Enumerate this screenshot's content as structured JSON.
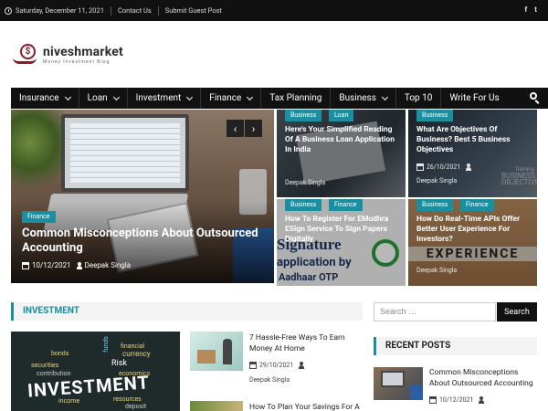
{
  "topbar": {
    "date": "Saturday, December 11, 2021",
    "links": [
      "Contact Us",
      "Submit Guest Post"
    ],
    "social": [
      "f",
      "t"
    ]
  },
  "logo": {
    "mark": "$",
    "title": "niveshmarket",
    "tagline": "Money Investment Blog"
  },
  "nav": {
    "items": [
      {
        "label": "Insurance",
        "dropdown": true
      },
      {
        "label": "Loan",
        "dropdown": true
      },
      {
        "label": "Investment",
        "dropdown": true
      },
      {
        "label": "Finance",
        "dropdown": true
      },
      {
        "label": "Tax Planning",
        "dropdown": false
      },
      {
        "label": "Business",
        "dropdown": true
      },
      {
        "label": "Top 10",
        "dropdown": false
      },
      {
        "label": "Write For Us",
        "dropdown": false
      }
    ]
  },
  "hero": {
    "category": "Finance",
    "title": "Common Misconceptions About Outsourced Accounting",
    "date": "10/12/2021",
    "author": "Deepak Singla",
    "prev": "‹",
    "next": "›"
  },
  "tiles": [
    {
      "cats": [
        "Business",
        "Loan"
      ],
      "title": "Here's Your Simplified Reading Of A Business Loan Application In India",
      "date": "",
      "author": "Deepak Singla"
    },
    {
      "cats": [
        "Business"
      ],
      "title": "What Are Objectives Of Business? Best 5 Business Objectives",
      "date": "26/10/2021",
      "author": "Deepak Singla"
    },
    {
      "cats": [
        "Business",
        "Finance"
      ],
      "title": "How To Register For EMudhra ESign Service To Sign Papers Digitally",
      "date": "",
      "author": ""
    },
    {
      "cats": [
        "Business",
        "Finance"
      ],
      "title": "How Do Real-Time APIs Offer Better User Experience For Investors?",
      "date": "",
      "author": "Deepak Singla"
    }
  ],
  "tile_image_text": {
    "signature": "Signature",
    "application_by": "application by",
    "aadhaar": "Aadhaar OTP",
    "experience": "EXPERIENCE",
    "objective": "BUSINESS OBJECTIVE",
    "training": "Training"
  },
  "investment_section": {
    "heading": "INVESTMENT",
    "image_words": [
      "bonds",
      "funds",
      "financial",
      "currency",
      "securities",
      "Risk",
      "contribution",
      "economics",
      "income",
      "resources",
      "deposit",
      "INVESTMENT"
    ],
    "posts": [
      {
        "title": "7 Hassle-Free Ways To Earn Money At Home",
        "date": "29/10/2021",
        "author": "Deepak Singla"
      },
      {
        "title": "How To Plan Your Savings For A",
        "date": "",
        "author": ""
      }
    ]
  },
  "sidebar": {
    "search_placeholder": "Search …",
    "search_button": "Search",
    "recent_heading": "RECENT POSTS",
    "recent": [
      {
        "title": "Common Misconceptions About Outsourced Accounting",
        "date": "10/12/2021"
      }
    ]
  },
  "colors": {
    "accent": "#1b8fa0",
    "nav_bg": "#111111",
    "brand": "#8b1a2e"
  }
}
